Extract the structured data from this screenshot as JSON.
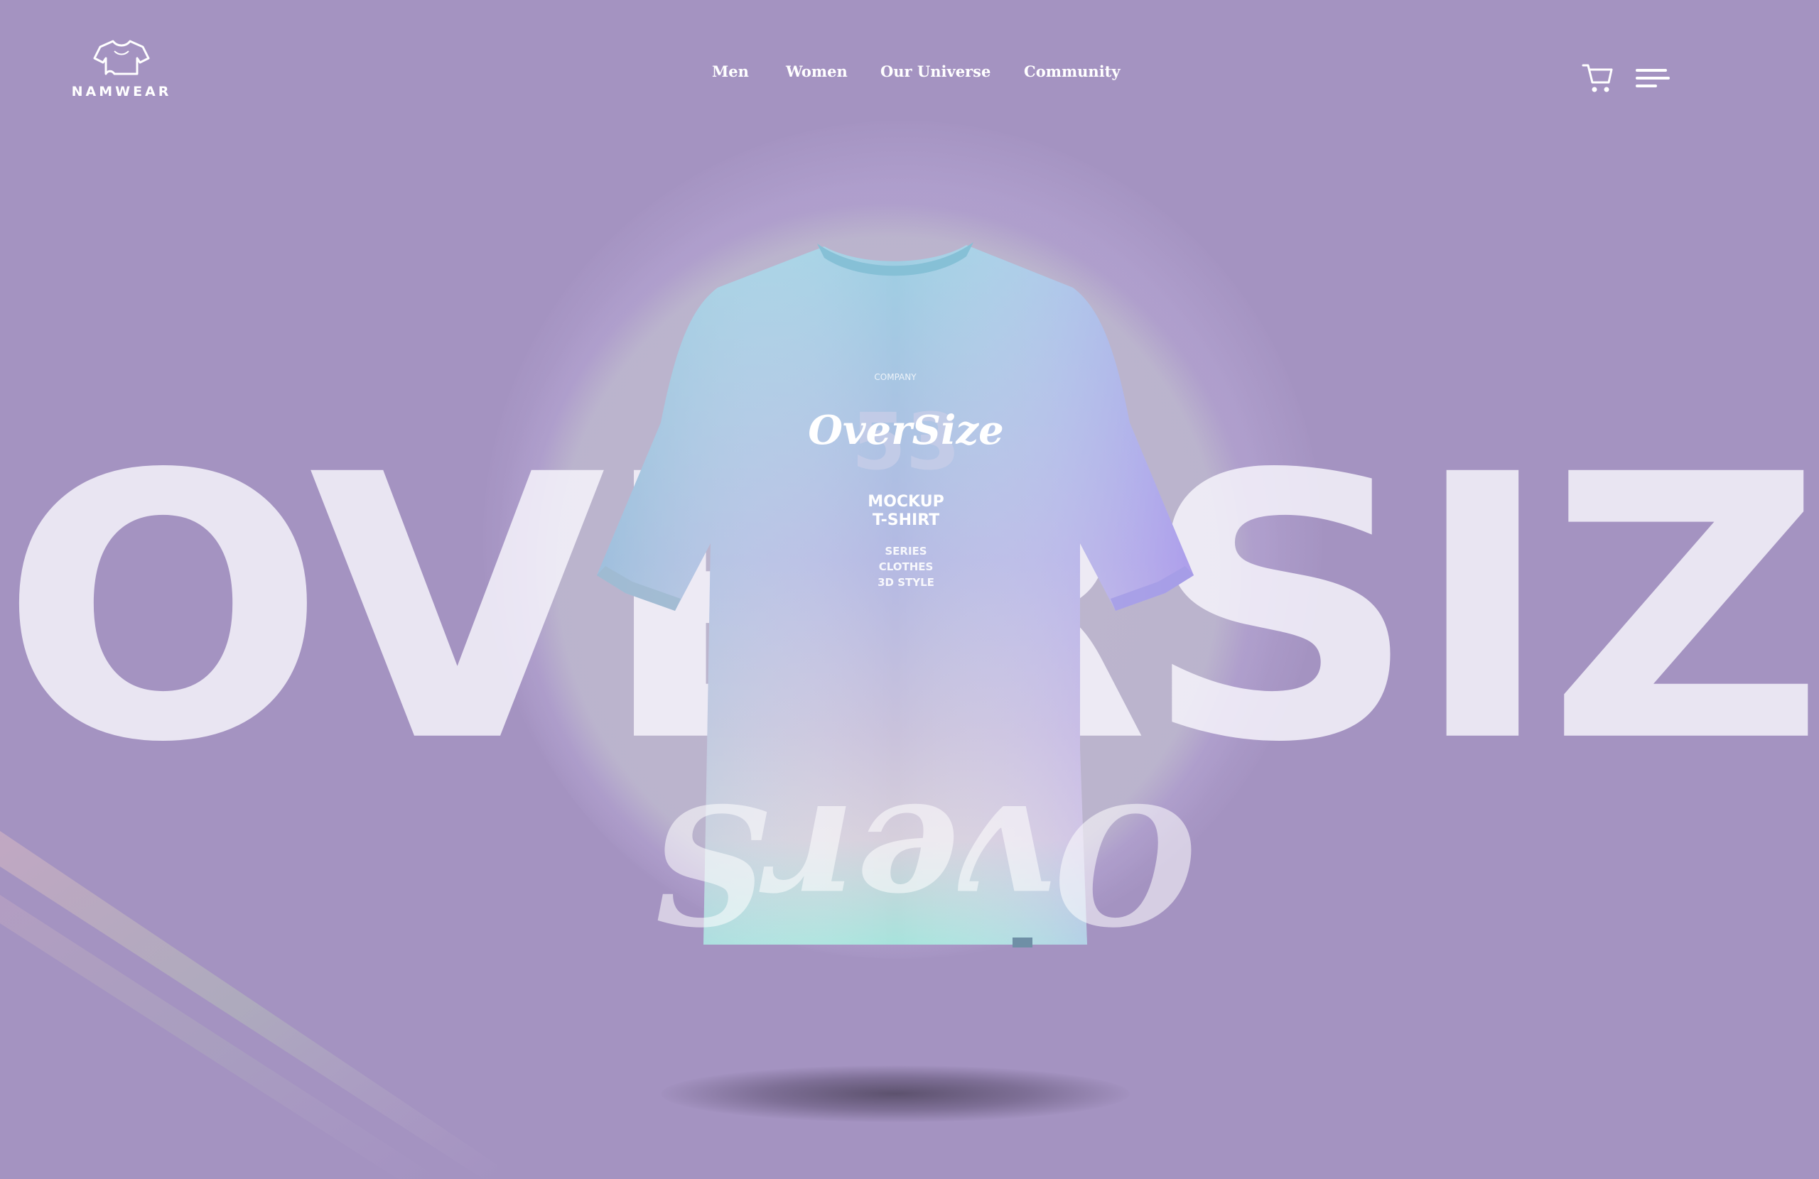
{
  "brand": {
    "name": "NAMWEAR",
    "icon": "tshirt-outline-icon"
  },
  "nav": {
    "items": [
      {
        "label": "Men"
      },
      {
        "label": "Women"
      },
      {
        "label": "Our Universe"
      },
      {
        "label": "Community"
      }
    ]
  },
  "actions": {
    "cart_icon": "cart-icon",
    "menu_icon": "hamburger-menu-icon"
  },
  "hero": {
    "headline": "OVERSIZED",
    "product": {
      "print_small": "COMPANY",
      "print_logo": "OverSize",
      "print_number": "53",
      "print_lines": [
        "MOCKUP",
        "T-SHIRT"
      ],
      "print_small_lines": [
        "SERIES",
        "CLOTHES",
        "3D STYLE"
      ],
      "hem_print": "OverS"
    }
  },
  "colors": {
    "background": "#a493c1",
    "text": "#ffffff",
    "headline": "#f3f0f8",
    "shirt_gradient": [
      "#9fcbe0",
      "#b3a8e8",
      "#c7c0dc",
      "#a8e0dc"
    ]
  }
}
